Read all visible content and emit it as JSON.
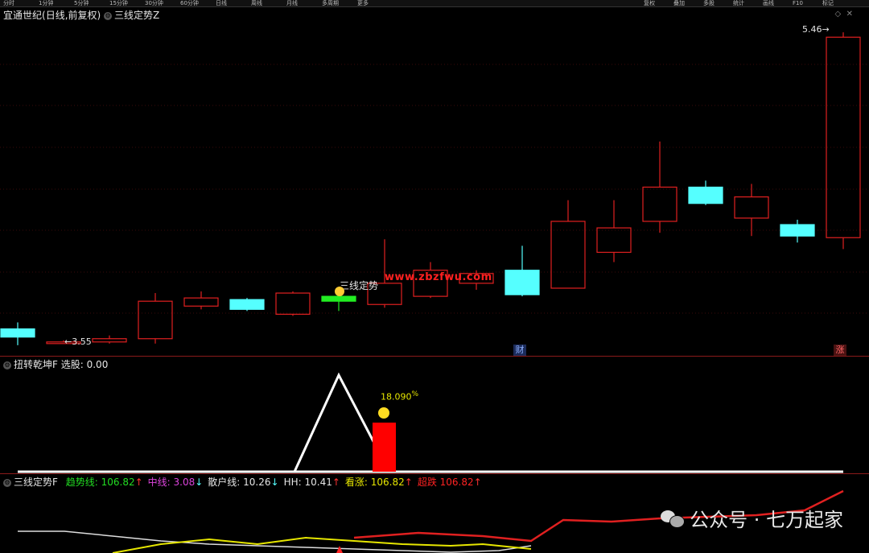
{
  "toolbar": {
    "left_items": [
      "分时",
      "1分钟",
      "5分钟",
      "15分钟",
      "30分钟",
      "60分钟",
      "日线",
      "周线",
      "月线",
      "多周期",
      "更多"
    ],
    "right_items": [
      "复权",
      "叠加",
      "多股",
      "统计",
      "画线",
      "F10",
      "标记"
    ]
  },
  "main": {
    "stock_name": "宜通世纪",
    "period": "(日线,前复权)",
    "indicator": "三线定势Z",
    "high_label": "5.46",
    "low_label": "3.55",
    "signal_label": "三线定势",
    "watermark": "www.zbzfwu.com",
    "marker_cai": "财",
    "marker_zhang": "涨"
  },
  "sub1": {
    "name": "扭转乾坤F",
    "field": "选股:",
    "value": "0.00",
    "pct": "18.090",
    "pct_unit": "%"
  },
  "sub2": {
    "name": "三线定势F",
    "items": [
      {
        "label": "趋势线:",
        "value": "106.82",
        "arrow": "↑",
        "color": "#22dd22"
      },
      {
        "label": "中线:",
        "value": "3.08",
        "arrow": "↓",
        "color": "#dd44dd"
      },
      {
        "label": "散户线:",
        "value": "10.26",
        "arrow": "↓",
        "color": "#e6e6e6"
      },
      {
        "label": "HH:",
        "value": "10.41",
        "arrow": "↑",
        "color": "#e6e6e6"
      },
      {
        "label": "看涨:",
        "value": "106.82",
        "arrow": "↑",
        "color": "#e6e600"
      },
      {
        "label": "超跌",
        "value": "106.82",
        "arrow": "↑",
        "color": "#ff2222"
      }
    ]
  },
  "wechat": {
    "text": "公众号 · 七万起家"
  },
  "colors": {
    "up": "#e02020",
    "down": "#55ffff",
    "flat_green": "#22ee22",
    "bg": "#000000"
  },
  "chart_data": {
    "type": "candlestick",
    "candles": [
      {
        "o": 3.64,
        "c": 3.59,
        "h": 3.68,
        "l": 3.54,
        "dir": "down"
      },
      {
        "o": 3.55,
        "c": 3.56,
        "h": 3.57,
        "l": 3.55,
        "dir": "up"
      },
      {
        "o": 3.56,
        "c": 3.58,
        "h": 3.6,
        "l": 3.55,
        "dir": "up"
      },
      {
        "o": 3.58,
        "c": 3.81,
        "h": 3.86,
        "l": 3.55,
        "dir": "up"
      },
      {
        "o": 3.78,
        "c": 3.83,
        "h": 3.87,
        "l": 3.76,
        "dir": "up"
      },
      {
        "o": 3.82,
        "c": 3.76,
        "h": 3.83,
        "l": 3.75,
        "dir": "down"
      },
      {
        "o": 3.73,
        "c": 3.86,
        "h": 3.87,
        "l": 3.72,
        "dir": "up"
      },
      {
        "o": 3.84,
        "c": 3.81,
        "h": 3.84,
        "l": 3.75,
        "dir": "green"
      },
      {
        "o": 3.79,
        "c": 3.92,
        "h": 4.19,
        "l": 3.77,
        "dir": "up"
      },
      {
        "o": 3.84,
        "c": 4.0,
        "h": 4.05,
        "l": 3.83,
        "dir": "up"
      },
      {
        "o": 3.92,
        "c": 3.98,
        "h": 4.0,
        "l": 3.88,
        "dir": "up"
      },
      {
        "o": 4.0,
        "c": 3.85,
        "h": 4.15,
        "l": 3.84,
        "dir": "down"
      },
      {
        "o": 3.89,
        "c": 4.3,
        "h": 4.43,
        "l": 3.89,
        "dir": "up"
      },
      {
        "o": 4.11,
        "c": 4.26,
        "h": 4.43,
        "l": 4.05,
        "dir": "up"
      },
      {
        "o": 4.3,
        "c": 4.51,
        "h": 4.79,
        "l": 4.23,
        "dir": "up"
      },
      {
        "o": 4.51,
        "c": 4.41,
        "h": 4.55,
        "l": 4.4,
        "dir": "down"
      },
      {
        "o": 4.32,
        "c": 4.45,
        "h": 4.53,
        "l": 4.21,
        "dir": "up"
      },
      {
        "o": 4.21,
        "c": 4.28,
        "h": 4.31,
        "l": 4.17,
        "dir": "down"
      },
      {
        "o": 4.2,
        "c": 5.43,
        "h": 5.46,
        "l": 4.13,
        "dir": "up"
      }
    ],
    "price_range": [
      3.48,
      5.52
    ],
    "sub1": {
      "signal_bar_value": 1,
      "pct": 18.09
    }
  }
}
